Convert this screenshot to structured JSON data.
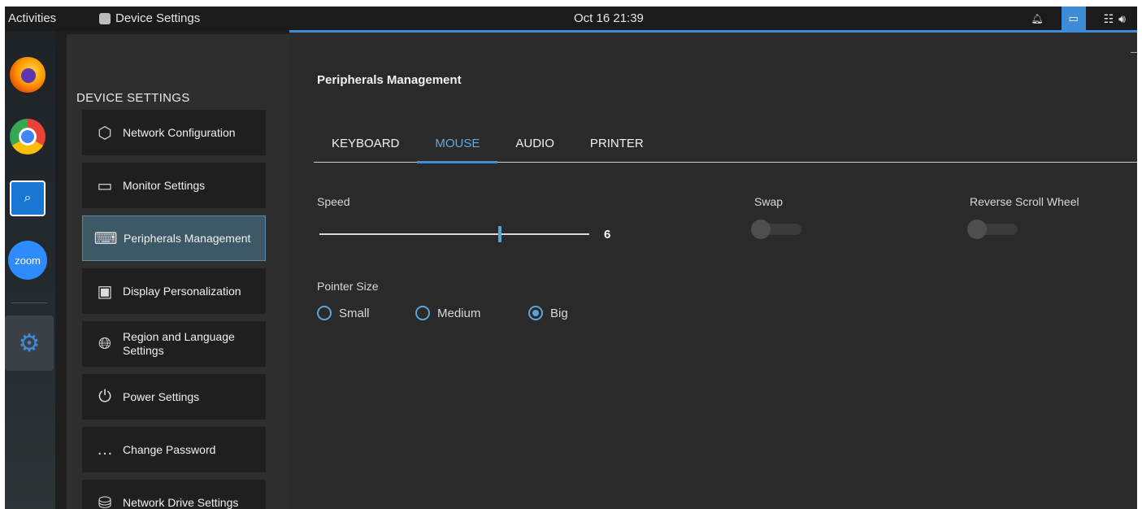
{
  "topbar": {
    "activities": "Activities",
    "app_name": "Device Settings",
    "clock": "Oct 16  21:39"
  },
  "dock": {
    "apps": [
      "firefox-icon",
      "chrome-icon",
      "file-search-icon",
      "zoom-icon",
      "settings-tools-icon"
    ],
    "zoom_label": "zoom"
  },
  "sidebar": {
    "header": "DEVICE SETTINGS",
    "items": [
      {
        "label": "Network Configuration",
        "icon": "network-icon"
      },
      {
        "label": "Monitor Settings",
        "icon": "monitor-icon"
      },
      {
        "label": "Peripherals Management",
        "icon": "keyboard-icon",
        "active": true
      },
      {
        "label": "Display Personalization",
        "icon": "display-icon"
      },
      {
        "label": "Region and Language Settings",
        "icon": "globe-icon"
      },
      {
        "label": "Power Settings",
        "icon": "power-plug-icon"
      },
      {
        "label": "Change Password",
        "icon": "password-icon"
      },
      {
        "label": "Network Drive Settings",
        "icon": "network-drive-icon"
      }
    ]
  },
  "main": {
    "title": "Peripherals Management",
    "tabs": [
      "KEYBOARD",
      "MOUSE",
      "AUDIO",
      "PRINTER"
    ],
    "active_tab": "MOUSE",
    "speed_label": "Speed",
    "speed_value": "6",
    "speed_fraction": 0.67,
    "swap_label": "Swap",
    "swap_on": false,
    "reverse_scroll_label": "Reverse Scroll Wheel",
    "reverse_scroll_on": false,
    "pointer_size_label": "Pointer Size",
    "pointer_sizes": [
      "Small",
      "Medium",
      "Big"
    ],
    "pointer_size_selected": "Big"
  },
  "colors": {
    "accent": "#3f8cd6",
    "active_nav": "#3d5867",
    "background": "#2a2a2a"
  }
}
